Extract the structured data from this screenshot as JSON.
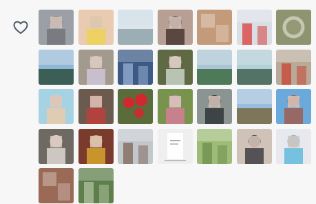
{
  "like_icon": {
    "icon": "heart-outline-icon",
    "color": "#4a5a6a"
  },
  "grid": {
    "columns": 7,
    "photos": [
      {
        "id": "p01",
        "subject": "portrait",
        "bg": "#9aa0a6",
        "accent": "#6d6f73"
      },
      {
        "id": "p02",
        "subject": "portrait",
        "bg": "#e8cbb0",
        "accent": "#f0d24a"
      },
      {
        "id": "p03",
        "subject": "landscape",
        "bg": "#cfdde3",
        "accent": "#8fa3a9"
      },
      {
        "id": "p04",
        "subject": "portrait",
        "bg": "#b79f94",
        "accent": "#3a2a25"
      },
      {
        "id": "p05",
        "subject": "indoor",
        "bg": "#b9865f",
        "accent": "#e8dccd"
      },
      {
        "id": "p06",
        "subject": "scene",
        "bg": "#d9dde4",
        "accent": "#d8322e"
      },
      {
        "id": "p07",
        "subject": "object",
        "bg": "#8f9470",
        "accent": "#f2f2e6"
      },
      {
        "id": "p08",
        "subject": "landscape",
        "bg": "#6aa1c9",
        "accent": "#2f4d3a"
      },
      {
        "id": "p09",
        "subject": "portrait",
        "bg": "#a19a8d",
        "accent": "#d7c9e0"
      },
      {
        "id": "p10",
        "subject": "scene",
        "bg": "#3d5a86",
        "accent": "#9eb6d8"
      },
      {
        "id": "p11",
        "subject": "portrait",
        "bg": "#5f6a44",
        "accent": "#d7e1d8"
      },
      {
        "id": "p12",
        "subject": "landscape",
        "bg": "#8eb3c9",
        "accent": "#3f6b3f"
      },
      {
        "id": "p13",
        "subject": "landscape",
        "bg": "#98c0c7",
        "accent": "#415f4d"
      },
      {
        "id": "p14",
        "subject": "scene",
        "bg": "#b7aa98",
        "accent": "#cc3b2c"
      },
      {
        "id": "p15",
        "subject": "portrait",
        "bg": "#a6d3e3",
        "accent": "#f1c9a1"
      },
      {
        "id": "p16",
        "subject": "portrait",
        "bg": "#6b5b4e",
        "accent": "#c93a3a"
      },
      {
        "id": "p17",
        "subject": "flowers",
        "bg": "#5a6c3c",
        "accent": "#d8252d"
      },
      {
        "id": "p18",
        "subject": "portrait",
        "bg": "#78934d",
        "accent": "#e17ba3"
      },
      {
        "id": "p19",
        "subject": "portrait",
        "bg": "#8c9492",
        "accent": "#24282b"
      },
      {
        "id": "p20",
        "subject": "landscape",
        "bg": "#77a7d4",
        "accent": "#7e6a3c"
      },
      {
        "id": "p21",
        "subject": "portrait",
        "bg": "#6aa9da",
        "accent": "#a5543c"
      },
      {
        "id": "p22",
        "subject": "portrait",
        "bg": "#6e6962",
        "accent": "#ece7e2"
      },
      {
        "id": "p23",
        "subject": "portrait",
        "bg": "#7a3a2e",
        "accent": "#e4b32c"
      },
      {
        "id": "p24",
        "subject": "scene",
        "bg": "#c2c7cc",
        "accent": "#7a5f4f"
      },
      {
        "id": "p25",
        "subject": "document",
        "bg": "#efefef",
        "accent": "#9a9a9a"
      },
      {
        "id": "p26",
        "subject": "scene",
        "bg": "#9ebb77",
        "accent": "#6a8b4a"
      },
      {
        "id": "p27",
        "subject": "portrait",
        "bg": "#cfc3b8",
        "accent": "#2c2c34"
      },
      {
        "id": "p28",
        "subject": "portrait",
        "bg": "#e7e9ee",
        "accent": "#4fb4db"
      },
      {
        "id": "p29",
        "subject": "indoor",
        "bg": "#8b5a48",
        "accent": "#c99a85"
      },
      {
        "id": "p30",
        "subject": "scene",
        "bg": "#5e7f4b",
        "accent": "#b6c6a6"
      }
    ]
  }
}
